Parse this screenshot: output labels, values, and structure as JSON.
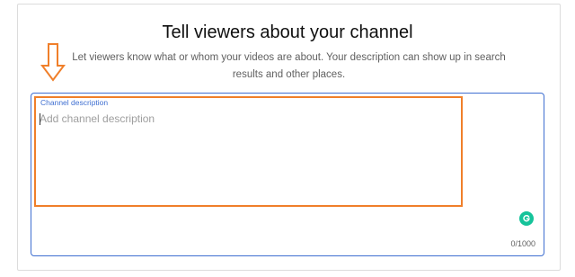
{
  "section": {
    "title": "Tell viewers about your channel",
    "subtitle": "Let viewers know what or whom your videos are about. Your description can show up in search results and other places."
  },
  "description": {
    "label": "Channel description",
    "placeholder": "Add channel description",
    "value": "",
    "counter": "0/1000"
  },
  "annotations": {
    "arrow_icon": "down-arrow-outline-icon",
    "highlight_color": "#f07f2a"
  },
  "colors": {
    "focus_border": "#3f6fd1",
    "grammarly": "#15c39a"
  }
}
